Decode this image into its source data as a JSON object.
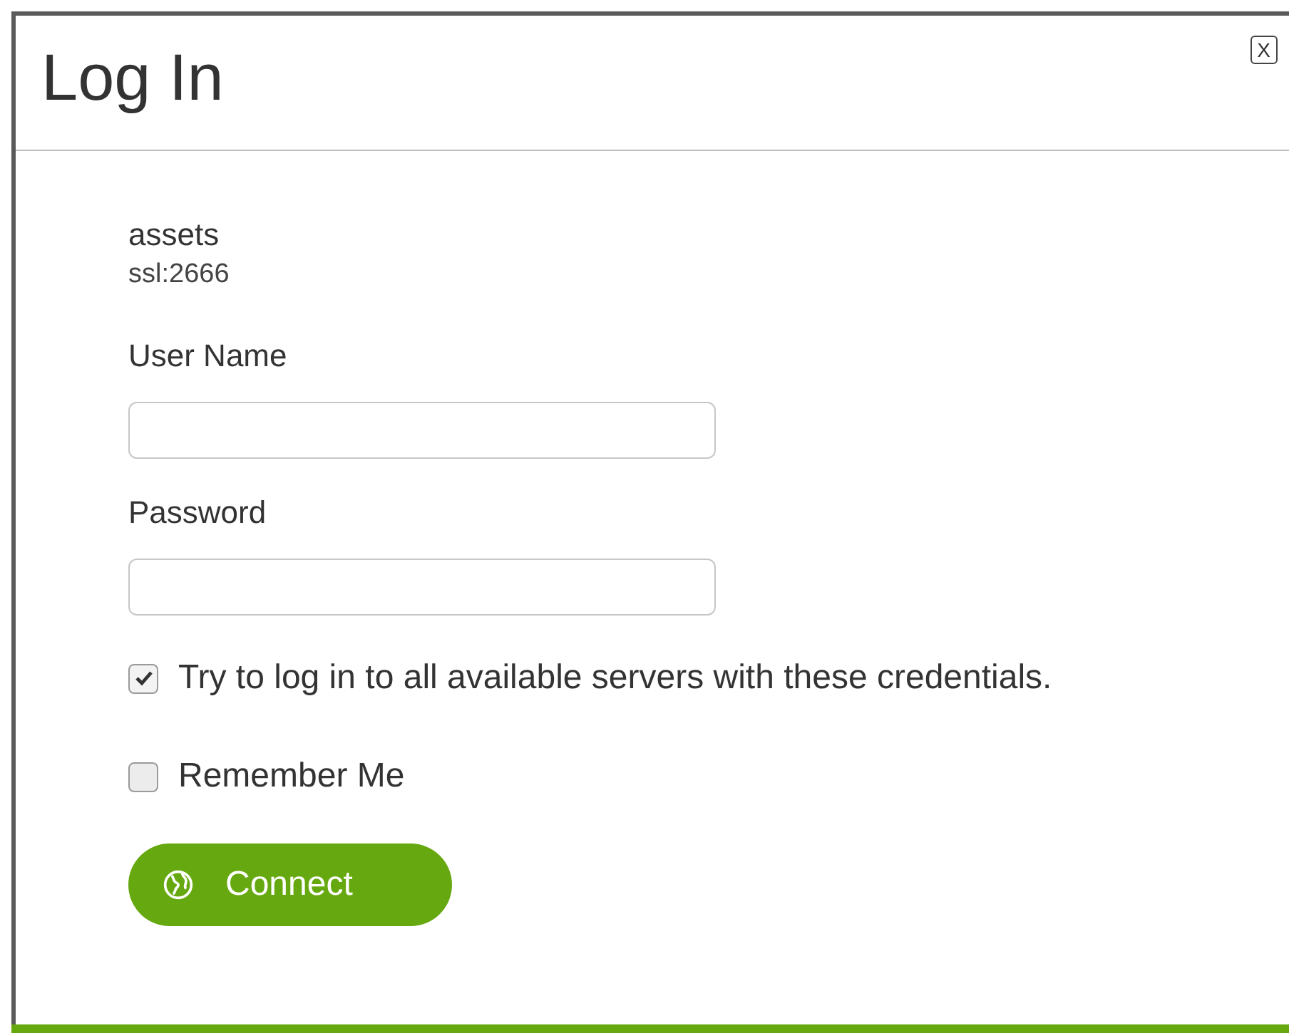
{
  "dialog": {
    "title": "Log In",
    "close_label": "X"
  },
  "server": {
    "name": "assets",
    "address": "ssl:2666"
  },
  "fields": [
    {
      "label": "User Name"
    },
    {
      "label": "Password"
    }
  ],
  "options": [
    {
      "label": "Try to log in to all available servers with these credentials.",
      "checked": true
    },
    {
      "label": "Remember Me",
      "checked": false
    }
  ],
  "connect_button": {
    "label": "Connect"
  }
}
